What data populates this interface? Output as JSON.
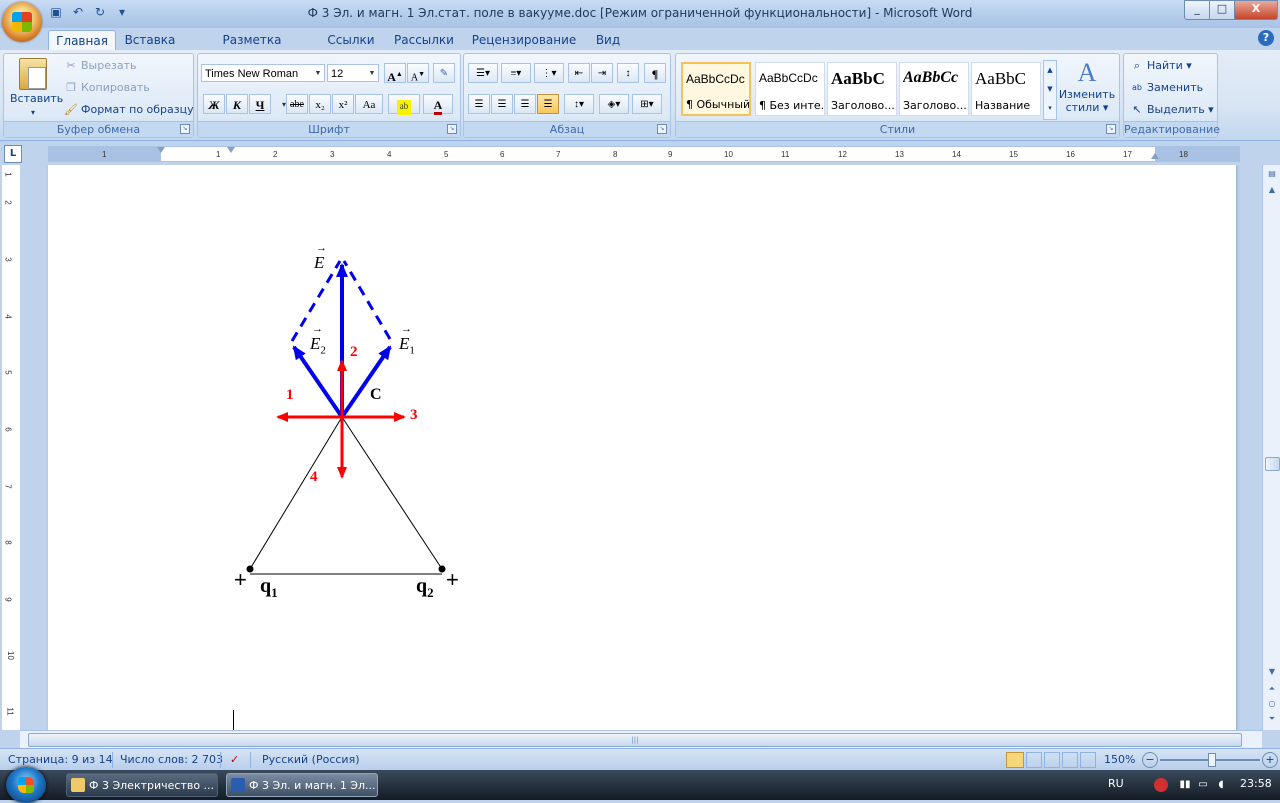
{
  "window": {
    "title": "Ф 3 Эл. и магн. 1 Эл.стат. поле в вакууме.doc [Режим ограниченной функциональности] - Microsoft Word",
    "min": "_",
    "max": "□",
    "close": "X"
  },
  "tabs": [
    "Главная",
    "Вставка",
    "Разметка страницы",
    "Ссылки",
    "Рассылки",
    "Рецензирование",
    "Вид"
  ],
  "ribbon": {
    "clipboard": {
      "label": "Буфер обмена",
      "paste": "Вставить",
      "cut": "Вырезать",
      "copy": "Копировать",
      "format_painter": "Формат по образцу"
    },
    "font": {
      "label": "Шрифт",
      "name": "Times New Roman",
      "size": "12",
      "bold": "Ж",
      "italic": "К",
      "underline": "Ч",
      "strike": "abe",
      "subscript": "x₂",
      "superscript": "x²",
      "case": "Aa"
    },
    "paragraph": {
      "label": "Абзац"
    },
    "styles": {
      "label": "Стили",
      "items": [
        {
          "sample": "AaBbCcDc",
          "name": "¶ Обычный"
        },
        {
          "sample": "AaBbCcDc",
          "name": "¶ Без инте..."
        },
        {
          "sample": "AaBbC",
          "name": "Заголово..."
        },
        {
          "sample": "AaBbCc",
          "name": "Заголово..."
        },
        {
          "sample": "AaBbC",
          "name": "Название"
        }
      ],
      "change_styles_line1": "Изменить",
      "change_styles_line2": "стили"
    },
    "editing": {
      "label": "Редактирование",
      "find": "Найти",
      "replace": "Заменить",
      "select": "Выделить"
    }
  },
  "ruler": {
    "corner": "L",
    "h_ticks": [
      "2",
      "1",
      "1",
      "2",
      "3",
      "4",
      "5",
      "6",
      "7",
      "8",
      "9",
      "10",
      "11",
      "12",
      "13",
      "14",
      "15",
      "16",
      "17",
      "18"
    ],
    "v_ticks": [
      "1",
      "2",
      "3",
      "4",
      "5",
      "6",
      "7",
      "8",
      "9",
      "10",
      "11"
    ]
  },
  "figure": {
    "labels": {
      "E": "E",
      "E1": "E",
      "E1_sub": "1",
      "E2": "E",
      "E2_sub": "2",
      "C": "C",
      "n1": "1",
      "n2": "2",
      "n3": "3",
      "n4": "4",
      "q1": "q",
      "q1_sub": "1",
      "q2": "q",
      "q2_sub": "2",
      "plus": "+"
    },
    "colors": {
      "blue": "#0000ee",
      "red": "#ff0000",
      "black": "#000000"
    }
  },
  "status": {
    "page": "Страница: 9 из 14",
    "words": "Число слов: 2 703",
    "language": "Русский (Россия)",
    "zoom": "150%"
  },
  "taskbar": {
    "tasks": [
      "Ф 3 Электричество ...",
      "Ф 3 Эл. и магн. 1 Эл..."
    ],
    "lang": "RU",
    "time": "23:58"
  }
}
